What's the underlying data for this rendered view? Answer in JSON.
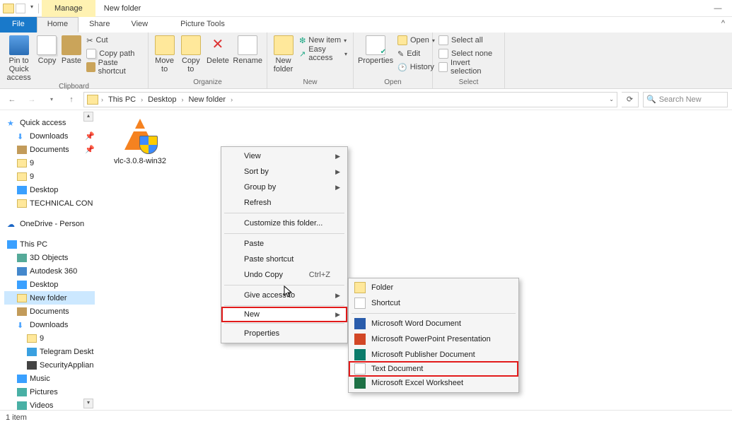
{
  "title": {
    "context_tab": "Manage",
    "window": "New folder"
  },
  "tabs": {
    "file": "File",
    "home": "Home",
    "share": "Share",
    "view": "View",
    "picture_tools": "Picture Tools"
  },
  "ribbon": {
    "clipboard": {
      "label": "Clipboard",
      "pin": "Pin to Quick access",
      "copy": "Copy",
      "paste": "Paste",
      "cut": "Cut",
      "copy_path": "Copy path",
      "paste_shortcut": "Paste shortcut"
    },
    "organize": {
      "label": "Organize",
      "move_to": "Move to",
      "copy_to": "Copy to",
      "delete": "Delete",
      "rename": "Rename"
    },
    "new": {
      "label": "New",
      "new_folder": "New folder",
      "new_item": "New item",
      "easy_access": "Easy access"
    },
    "open": {
      "label": "Open",
      "properties": "Properties",
      "open": "Open",
      "edit": "Edit",
      "history": "History"
    },
    "select": {
      "label": "Select",
      "select_all": "Select all",
      "select_none": "Select none",
      "invert": "Invert selection"
    }
  },
  "breadcrumb": {
    "c0": "This PC",
    "c1": "Desktop",
    "c2": "New folder"
  },
  "search": {
    "placeholder": "Search New"
  },
  "nav": {
    "quick_access": "Quick access",
    "downloads": "Downloads",
    "documents": "Documents",
    "nine": "9",
    "desktop": "Desktop",
    "technical": "TECHNICAL CON",
    "onedrive": "OneDrive - Person",
    "this_pc": "This PC",
    "objects3d": "3D Objects",
    "autodesk": "Autodesk 360",
    "new_folder": "New folder",
    "telegram": "Telegram Deskt",
    "security": "SecurityApplian",
    "music": "Music",
    "pictures": "Pictures",
    "videos": "Videos"
  },
  "file": {
    "name": "vlc-3.0.8-win32"
  },
  "ctx1": {
    "view": "View",
    "sort_by": "Sort by",
    "group_by": "Group by",
    "refresh": "Refresh",
    "customize": "Customize this folder...",
    "paste": "Paste",
    "paste_shortcut": "Paste shortcut",
    "undo": "Undo Copy",
    "undo_key": "Ctrl+Z",
    "give_access": "Give access to",
    "new": "New",
    "properties": "Properties"
  },
  "ctx2": {
    "folder": "Folder",
    "shortcut": "Shortcut",
    "word": "Microsoft Word Document",
    "ppt": "Microsoft PowerPoint Presentation",
    "pub": "Microsoft Publisher Document",
    "txt": "Text Document",
    "xls": "Microsoft Excel Worksheet"
  },
  "status": {
    "items": "1 item"
  }
}
